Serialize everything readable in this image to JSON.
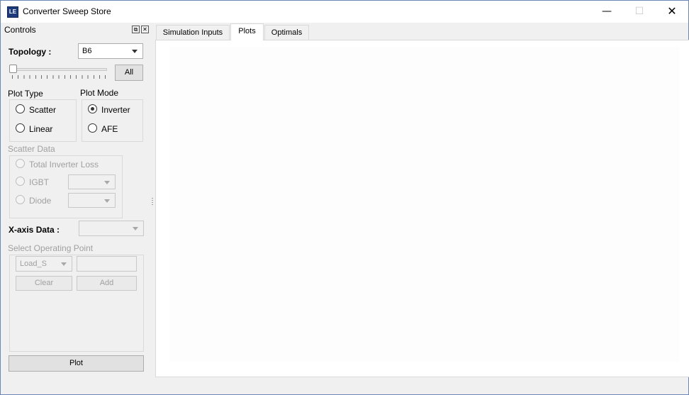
{
  "window": {
    "title": "Converter Sweep Store",
    "icon_text": "LE",
    "minimize": "—",
    "maximize": "☐",
    "close": "✕"
  },
  "controls": {
    "title": "Controls",
    "topology_label": "Topology :",
    "topology_value": "B6",
    "slider_value": 0,
    "all_button": "All",
    "plot_type": {
      "label": "Plot Type",
      "options": [
        "Scatter",
        "Linear"
      ],
      "selected": null
    },
    "plot_mode": {
      "label": "Plot Mode",
      "options": [
        "Inverter",
        "AFE"
      ],
      "selected": "Inverter"
    },
    "scatter_data": {
      "label": "Scatter Data",
      "total_inverter_loss": "Total Inverter Loss",
      "igbt": "IGBT",
      "diode": "Diode"
    },
    "xaxis_label": "X-axis Data :",
    "operating_point": {
      "label": "Select Operating Point",
      "combo_value": "Load_S",
      "clear": "Clear",
      "add": "Add"
    },
    "plot_button": "Plot"
  },
  "tabs": [
    {
      "label": "Simulation Inputs",
      "active": false
    },
    {
      "label": "Plots",
      "active": true
    },
    {
      "label": "Optimals",
      "active": false
    }
  ]
}
